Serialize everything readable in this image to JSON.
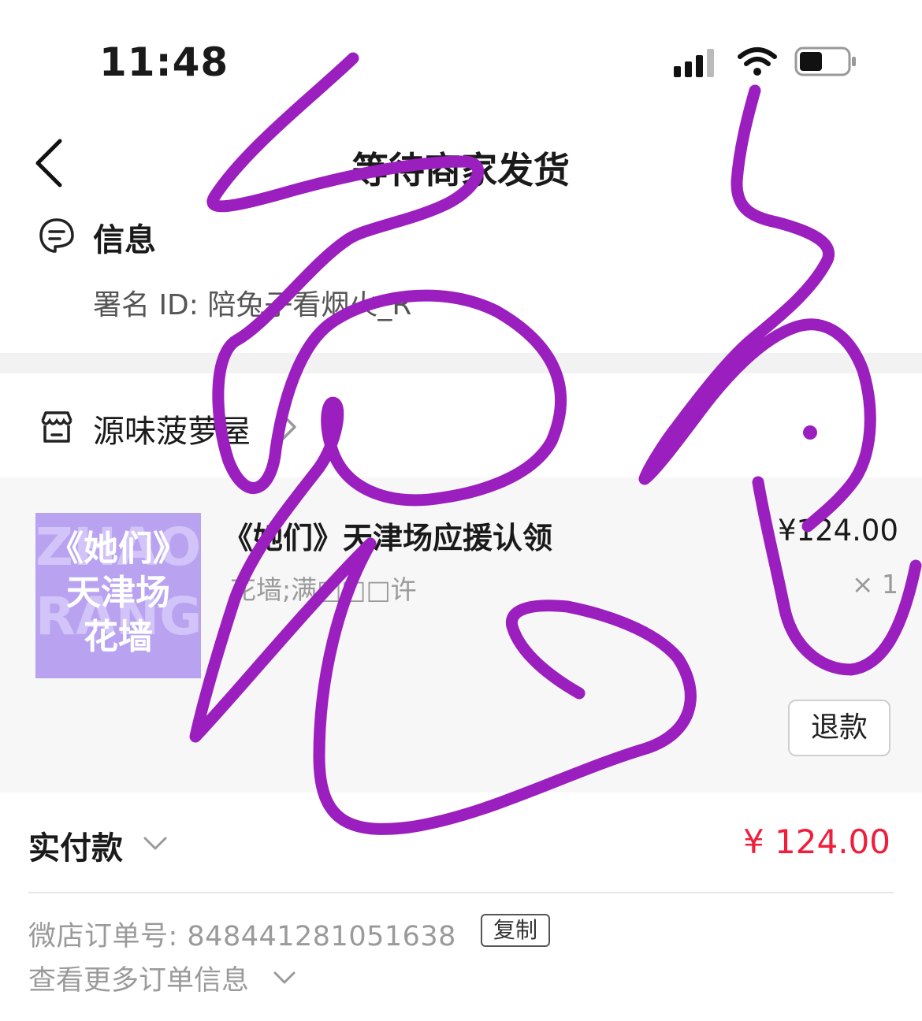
{
  "status_bar": {
    "time": "11:48"
  },
  "nav": {
    "title": "等待商家发货"
  },
  "info": {
    "title": "信息",
    "anonymous_id": "署名 ID: 陪兔子看烟火_R"
  },
  "shop": {
    "name": "源味菠萝屋"
  },
  "product": {
    "thumb_bg_text": "ZHAO\nRANG",
    "thumb_lines": [
      "《她们》",
      "天津场",
      "花墙"
    ],
    "title": "《她们》天津场应援认领",
    "spec": "花墙;满□□□许",
    "price": "¥124.00",
    "quantity": "× 1",
    "refund_label": "退款"
  },
  "payment": {
    "label": "实付款",
    "amount": "¥ 124.00"
  },
  "order": {
    "number_text": "微店订单号: 848441281051638",
    "copy_label": "复制",
    "more_info_label": "查看更多订单信息"
  },
  "colors": {
    "accent_red": "#f01e3c",
    "scribble": "#9b1fbf",
    "thumb_purple": "#b9a3f1"
  }
}
